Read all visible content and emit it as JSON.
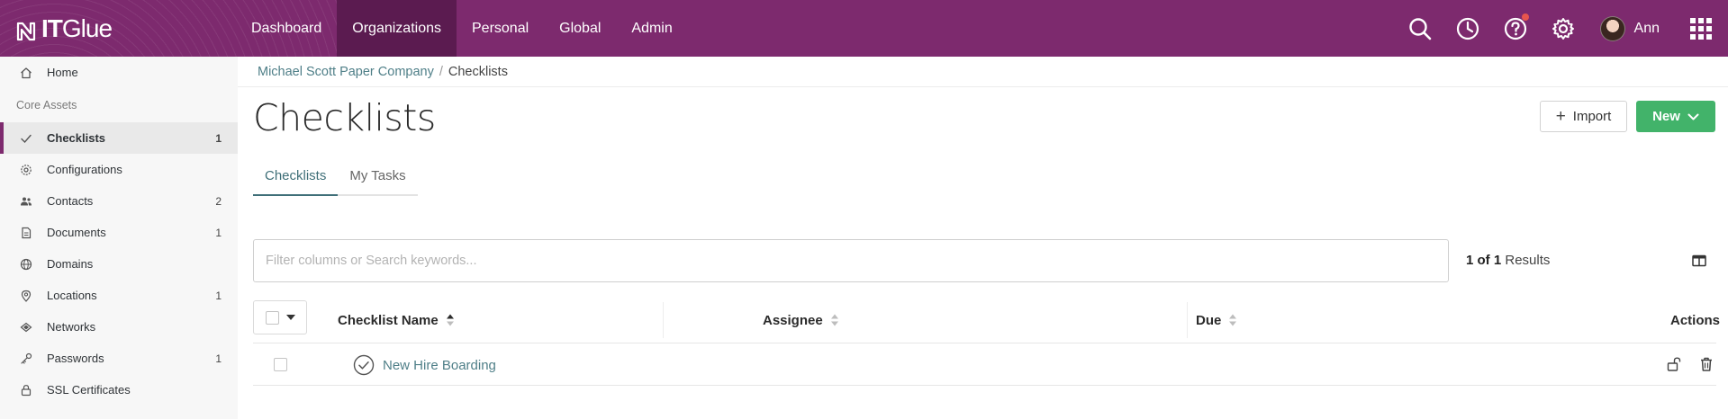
{
  "app": {
    "logo_it": "IT",
    "logo_glue": "Glue",
    "brand_color": "#7d2a6e"
  },
  "topnav": {
    "items": [
      {
        "label": "Dashboard"
      },
      {
        "label": "Organizations",
        "active": true
      },
      {
        "label": "Personal"
      },
      {
        "label": "Global"
      },
      {
        "label": "Admin"
      }
    ]
  },
  "user": {
    "name": "Ann"
  },
  "sidebar": {
    "home": {
      "label": "Home",
      "icon": "home-icon"
    },
    "section_label": "Core Assets",
    "items": [
      {
        "label": "Checklists",
        "count": "1",
        "icon": "check-icon",
        "active": true
      },
      {
        "label": "Configurations",
        "count": "",
        "icon": "gear-icon"
      },
      {
        "label": "Contacts",
        "count": "2",
        "icon": "people-icon"
      },
      {
        "label": "Documents",
        "count": "1",
        "icon": "document-icon"
      },
      {
        "label": "Domains",
        "count": "",
        "icon": "globe-icon"
      },
      {
        "label": "Locations",
        "count": "1",
        "icon": "map-pin-icon"
      },
      {
        "label": "Networks",
        "count": "",
        "icon": "network-icon"
      },
      {
        "label": "Passwords",
        "count": "1",
        "icon": "key-icon"
      },
      {
        "label": "SSL Certificates",
        "count": "",
        "icon": "lock-icon"
      }
    ]
  },
  "breadcrumb": {
    "org": "Michael Scott Paper Company",
    "separator": "/",
    "current": "Checklists"
  },
  "page": {
    "title": "Checklists",
    "import_label": "Import",
    "new_label": "New"
  },
  "tabs": [
    {
      "label": "Checklists",
      "active": true
    },
    {
      "label": "My Tasks"
    }
  ],
  "search": {
    "placeholder": "Filter columns or Search keywords...",
    "value": ""
  },
  "results": {
    "count": "1 of 1",
    "label": "Results"
  },
  "table": {
    "columns": [
      "Checklist Name",
      "Assignee",
      "Due",
      "Actions"
    ],
    "rows": [
      {
        "name": "New Hire Boarding",
        "assignee": "",
        "due": ""
      }
    ]
  },
  "colors": {
    "accent_green": "#42b36a",
    "link_teal": "#4f7f88"
  }
}
